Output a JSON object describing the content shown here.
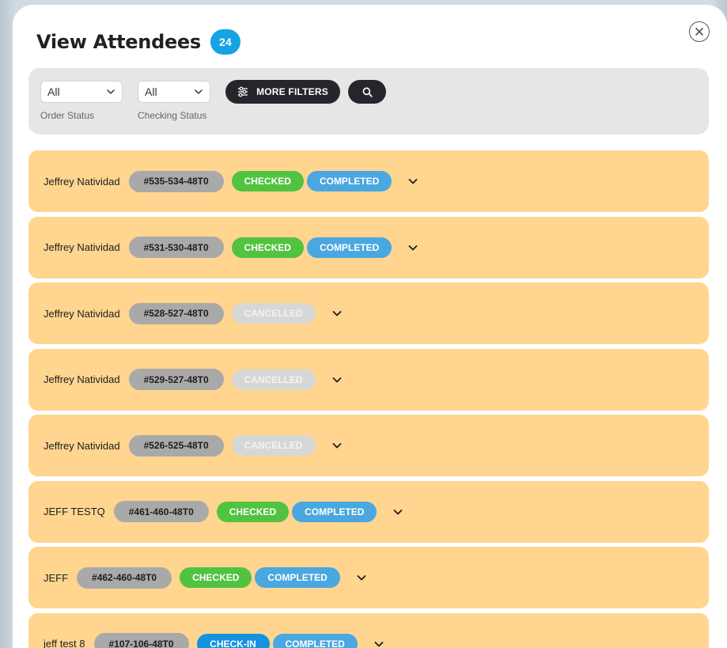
{
  "header": {
    "title": "View Attendees",
    "count": "24",
    "close_icon": "close-icon"
  },
  "filters": {
    "order_status": {
      "value": "All",
      "caption": "Order Status"
    },
    "checking_status": {
      "value": "All",
      "caption": "Checking Status"
    },
    "more_filters_label": "MORE FILTERS",
    "search_icon": "search-icon"
  },
  "colors": {
    "accent_badge": "#16a3e3",
    "row_background": "#ffd590",
    "checked": "#52c340",
    "completed": "#4aa7e0",
    "check_in": "#1393e0",
    "cancelled": "#d7d7d7"
  },
  "attendees": [
    {
      "name": "Jeffrey Natividad",
      "order": "#535-534-48T0",
      "statuses": [
        "CHECKED",
        "COMPLETED"
      ]
    },
    {
      "name": "Jeffrey Natividad",
      "order": "#531-530-48T0",
      "statuses": [
        "CHECKED",
        "COMPLETED"
      ]
    },
    {
      "name": "Jeffrey Natividad",
      "order": "#528-527-48T0",
      "statuses": [
        "CANCELLED"
      ]
    },
    {
      "name": "Jeffrey Natividad",
      "order": "#529-527-48T0",
      "statuses": [
        "CANCELLED"
      ]
    },
    {
      "name": "Jeffrey Natividad",
      "order": "#526-525-48T0",
      "statuses": [
        "CANCELLED"
      ]
    },
    {
      "name": "JEFF TESTQ",
      "order": "#461-460-48T0",
      "statuses": [
        "CHECKED",
        "COMPLETED"
      ]
    },
    {
      "name": "JEFF",
      "order": "#462-460-48T0",
      "statuses": [
        "CHECKED",
        "COMPLETED"
      ]
    },
    {
      "name": "jeff test 8",
      "order": "#107-106-48T0",
      "statuses": [
        "CHECK-IN",
        "COMPLETED"
      ]
    }
  ]
}
